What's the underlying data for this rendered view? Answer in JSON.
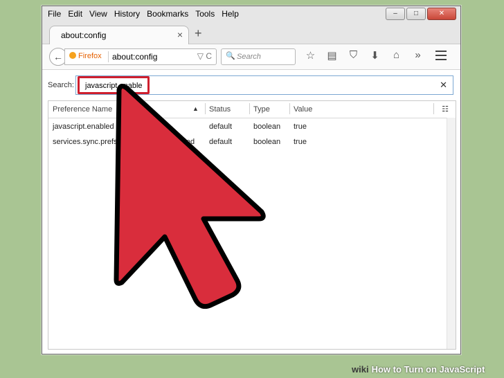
{
  "menu": [
    "File",
    "Edit",
    "View",
    "History",
    "Bookmarks",
    "Tools",
    "Help"
  ],
  "window_controls": [
    "–",
    "□",
    "✕"
  ],
  "tab": {
    "title": "about:config",
    "close": "×",
    "new_tab": "+"
  },
  "nav": {
    "back": "←",
    "identity_label": "Firefox",
    "url": "about:config",
    "url_icons": "▽ C",
    "search_placeholder": "Search",
    "search_icon": "🔍",
    "toolbar_icons": [
      "☆",
      "▤",
      "⛉",
      "⬇",
      "⌂",
      "»"
    ]
  },
  "config": {
    "search_label": "Search:",
    "search_value": "javascript.enable",
    "clear": "✕",
    "columns": [
      "Preference Name",
      "Status",
      "Type",
      "Value"
    ],
    "sort_indicator": "▲",
    "column_picker": "☷",
    "rows": [
      {
        "name": "javascript.enabled",
        "status": "default",
        "type": "boolean",
        "value": "true"
      },
      {
        "name": "services.sync.prefs.s",
        "name_tail": "enabled",
        "status": "default",
        "type": "boolean",
        "value": "true"
      }
    ]
  },
  "watermark": {
    "brand": "wiki",
    "text": "How to Turn on JavaScript"
  },
  "colors": {
    "highlight": "#cf1f2e",
    "arrow_fill": "#d92d3c",
    "background": "#a9c593"
  }
}
